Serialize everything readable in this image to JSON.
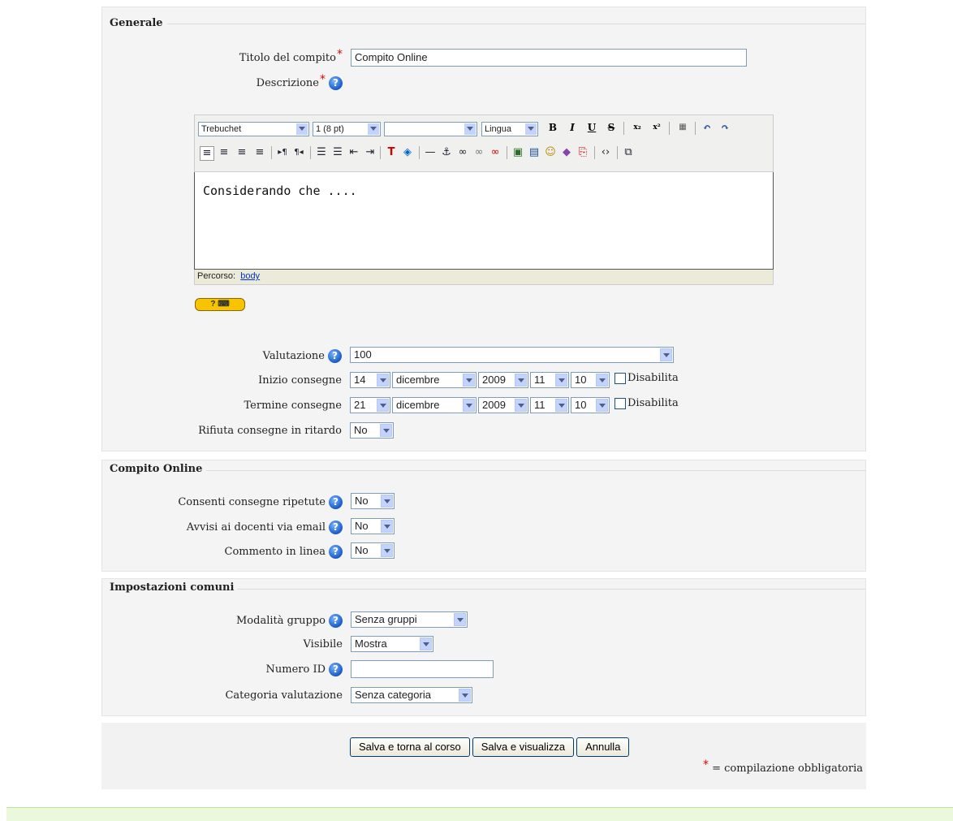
{
  "generale": {
    "legend": "Generale",
    "titolo_label": "Titolo del compito",
    "titolo_value": "Compito Online",
    "descrizione_label": "Descrizione",
    "editor": {
      "font": "Trebuchet",
      "size": "1 (8 pt)",
      "style": "",
      "lang": "Lingua",
      "content": "Considerando che ....",
      "path_label": "Percorso:",
      "path_link": "body"
    },
    "valutazione_label": "Valutazione",
    "valutazione_value": "100",
    "inizio_label": "Inizio consegne",
    "inizio": {
      "day": "14",
      "month": "dicembre",
      "year": "2009",
      "hour": "11",
      "min": "10"
    },
    "termine_label": "Termine consegne",
    "termine": {
      "day": "21",
      "month": "dicembre",
      "year": "2009",
      "hour": "11",
      "min": "10"
    },
    "disabilita": "Disabilita",
    "rifiuta_label": "Rifiuta consegne in ritardo",
    "rifiuta_value": "No"
  },
  "online": {
    "legend": "Compito Online",
    "ripetute_label": "Consenti consegne ripetute",
    "ripetute_value": "No",
    "avvisi_label": "Avvisi ai docenti via email",
    "avvisi_value": "No",
    "commento_label": "Commento in linea",
    "commento_value": "No"
  },
  "comuni": {
    "legend": "Impostazioni comuni",
    "gruppo_label": "Modalità gruppo",
    "gruppo_value": "Senza gruppi",
    "visibile_label": "Visibile",
    "visibile_value": "Mostra",
    "numero_label": "Numero ID",
    "numero_value": "",
    "categoria_label": "Categoria valutazione",
    "categoria_value": "Senza categoria"
  },
  "buttons": {
    "salva_torna": "Salva e torna al corso",
    "salva_visualizza": "Salva e visualizza",
    "annulla": "Annulla",
    "required_star": "*",
    "required_note": "= compilazione obbligatoria"
  }
}
